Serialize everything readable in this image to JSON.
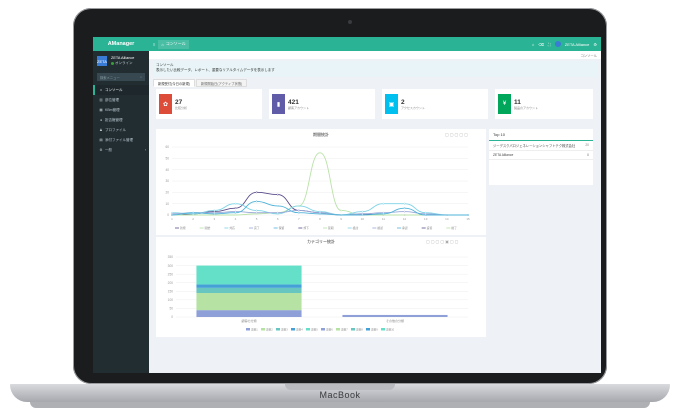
{
  "app": {
    "name": "AManager"
  },
  "user": {
    "name": "ZETA Alliance",
    "status": "オンライン",
    "avatar_text": "ZETA"
  },
  "sidebar": {
    "search_placeholder": "検索メニュー",
    "items": [
      {
        "label": "コンソール",
        "icon": "home-icon",
        "active": true
      },
      {
        "label": "部位管理",
        "icon": "bank-icon",
        "active": false
      },
      {
        "label": "KBm管理",
        "icon": "grid-icon",
        "active": false
      },
      {
        "label": "拒否権管理",
        "icon": "bell-icon",
        "active": false
      },
      {
        "label": "プロファイル",
        "icon": "user-icon",
        "active": false
      },
      {
        "label": "添付ファイル管理",
        "icon": "file-icon",
        "active": false
      },
      {
        "label": "一般",
        "icon": "gear-icon",
        "active": false
      }
    ]
  },
  "topbar": {
    "tab_label": "コンソール",
    "right_user": "ZETA Alliance"
  },
  "content": {
    "crumb": "コンソール",
    "tip_title": "コンソール",
    "tip_text": "表示したい比較データ、レポート、重要なリアルタイムデータを表示します",
    "subtabs": [
      "新規受付(今日の新規)",
      "新規開始日(アクティブ状態)"
    ]
  },
  "stats": [
    {
      "value": "27",
      "label": "比較分析",
      "color": "#dd4b39",
      "icon": "gift-icon"
    },
    {
      "value": "421",
      "label": "顧客アカウント",
      "color": "#605ca8",
      "icon": "book-icon"
    },
    {
      "value": "2",
      "label": "アクセスカウント",
      "color": "#00c0ef",
      "icon": "bag-icon"
    },
    {
      "value": "11",
      "label": "製品のアカウント",
      "color": "#00a65a",
      "icon": "dollar-icon"
    }
  ],
  "top10": {
    "title": "Top 10",
    "rows": [
      {
        "name": "ジーデスクパロジェネレーションシャフトテク株式会社",
        "value": "20"
      },
      {
        "name": "ZETA Alliance",
        "value": "8"
      }
    ]
  },
  "colors": {
    "accent": "#2ab394",
    "sidebar": "#222d32"
  },
  "chart_data": [
    {
      "type": "line",
      "title": "期間統計",
      "ylim": [
        0,
        60
      ],
      "y_ticks": [
        "0",
        "10",
        "20",
        "30",
        "40",
        "50",
        "60"
      ],
      "categories": [
        "1",
        "2",
        "3",
        "4",
        "5",
        "6",
        "7",
        "8",
        "9",
        "10",
        "11",
        "12",
        "13",
        "14",
        "15"
      ],
      "series": [
        {
          "color": "#5b4d8a",
          "values": [
            0,
            1,
            3,
            6,
            20,
            18,
            4,
            2,
            0,
            1,
            0,
            0,
            0,
            0,
            0
          ]
        },
        {
          "color": "#b8e2a7",
          "values": [
            0,
            0,
            0,
            0,
            1,
            2,
            8,
            55,
            4,
            0,
            0,
            0,
            0,
            0,
            0
          ]
        },
        {
          "color": "#7fd3e6",
          "values": [
            2,
            1,
            4,
            10,
            4,
            1,
            8,
            3,
            0,
            3,
            10,
            10,
            2,
            0,
            0
          ]
        },
        {
          "color": "#9aa8d8",
          "values": [
            1,
            2,
            2,
            3,
            2,
            2,
            4,
            2,
            0,
            1,
            2,
            3,
            1,
            0,
            0
          ]
        },
        {
          "color": "#4fb3d9",
          "values": [
            0,
            2,
            1,
            2,
            12,
            8,
            2,
            1,
            0,
            0,
            1,
            6,
            0,
            0,
            0
          ]
        }
      ],
      "legend": [
        "新規",
        "開始",
        "対応",
        "完了",
        "保留",
        "却下",
        "延期",
        "検討",
        "確認",
        "承認",
        "返答",
        "終了"
      ]
    },
    {
      "type": "bar",
      "title": "カテゴリー統計",
      "ylim": [
        0,
        350
      ],
      "y_ticks": [
        "0",
        "50",
        "100",
        "150",
        "200",
        "250",
        "300",
        "350"
      ],
      "categories": [
        "顧客の分類",
        "その他の分類"
      ],
      "stacked": true,
      "series": [
        {
          "color": "#8fa0d8",
          "values": [
            40,
            12
          ]
        },
        {
          "color": "#b6e3a3",
          "values": [
            100,
            0
          ]
        },
        {
          "color": "#67c7c0",
          "values": [
            30,
            0
          ]
        },
        {
          "color": "#46a0d8",
          "values": [
            20,
            0
          ]
        },
        {
          "color": "#64e0c8",
          "values": [
            110,
            0
          ]
        }
      ],
      "legend": [
        "項目1",
        "項目2",
        "項目3",
        "項目4",
        "項目5",
        "項目6",
        "項目7",
        "項目8",
        "項目9",
        "項目10"
      ]
    }
  ]
}
